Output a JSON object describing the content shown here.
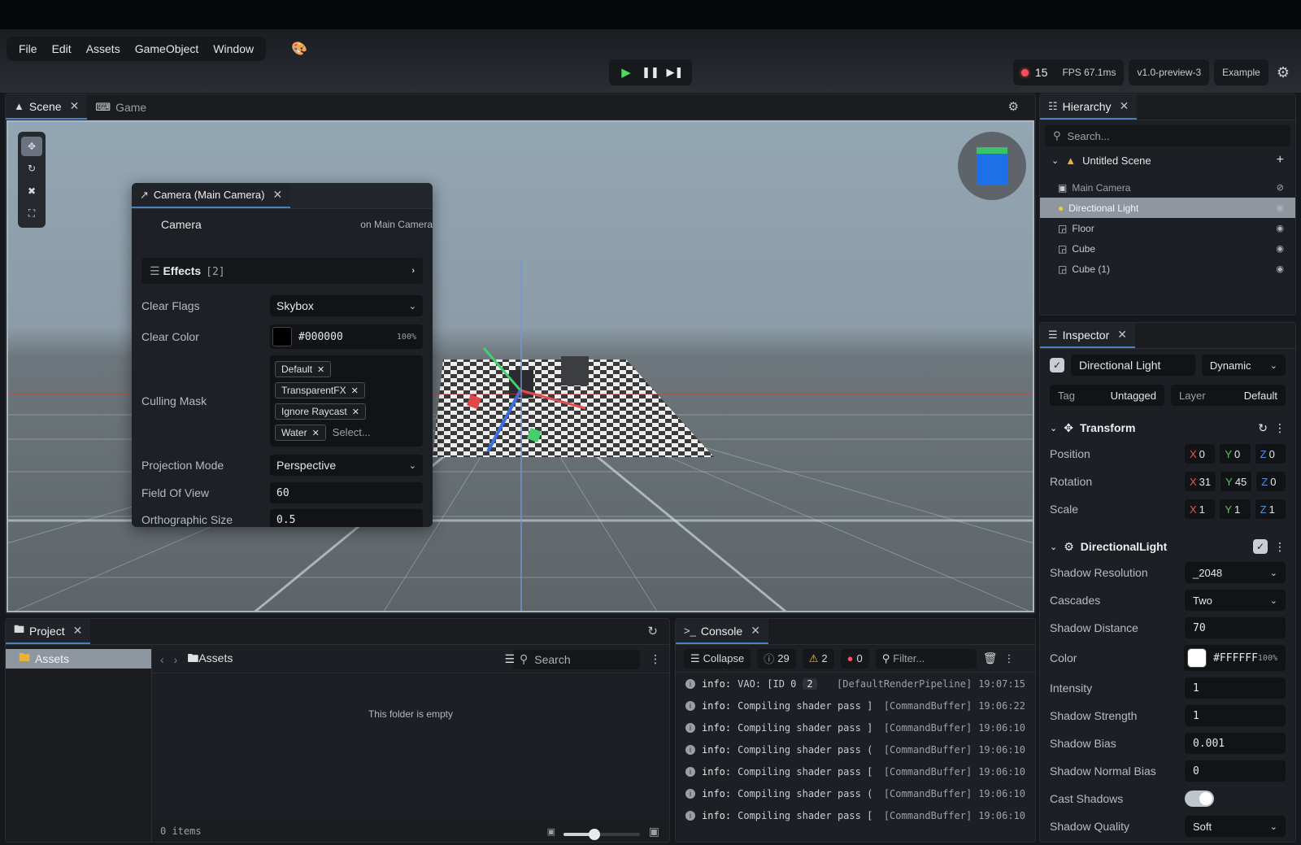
{
  "menu": [
    "File",
    "Edit",
    "Assets",
    "GameObject",
    "Window"
  ],
  "status": {
    "count": "15",
    "fps": "FPS 67.1ms",
    "version": "v1.0-preview-3",
    "project": "Example"
  },
  "scene_panel": {
    "tabs": [
      {
        "label": "Scene"
      },
      {
        "label": "Game"
      }
    ]
  },
  "camera_panel": {
    "tab": "Camera (Main Camera)",
    "component": "Camera",
    "owner": "on Main Camera",
    "effects_label": "Effects",
    "effects_count": "[2]",
    "clear_flags_label": "Clear Flags",
    "clear_flags": "Skybox",
    "clear_color_label": "Clear Color",
    "clear_color_hex": "#000000",
    "clear_color_alpha": "100%",
    "culling_mask_label": "Culling Mask",
    "culling_tags": [
      "Default",
      "TransparentFX",
      "Ignore Raycast",
      "Water"
    ],
    "culling_placeholder": "Select...",
    "projection_label": "Projection Mode",
    "projection": "Perspective",
    "fov_label": "Field Of View",
    "fov": "60",
    "ortho_label": "Orthographic Size",
    "ortho": "0.5"
  },
  "hierarchy": {
    "tab": "Hierarchy",
    "search_placeholder": "Search...",
    "scene": "Untitled Scene",
    "items": [
      "Main Camera",
      "Directional Light",
      "Floor",
      "Cube",
      "Cube (1)"
    ],
    "selected_index": 1
  },
  "inspector": {
    "tab": "Inspector",
    "object_name": "Directional Light",
    "mode": "Dynamic",
    "tag_label": "Tag",
    "tag": "Untagged",
    "layer_label": "Layer",
    "layer": "Default",
    "transform": {
      "title": "Transform",
      "position_label": "Position",
      "position": [
        "0",
        "0",
        "0"
      ],
      "rotation_label": "Rotation",
      "rotation": [
        "31",
        "45",
        "0"
      ],
      "scale_label": "Scale",
      "scale": [
        "1",
        "1",
        "1"
      ]
    },
    "light": {
      "title": "DirectionalLight",
      "shadow_resolution_label": "Shadow Resolution",
      "shadow_resolution": "_2048",
      "cascades_label": "Cascades",
      "cascades": "Two",
      "shadow_distance_label": "Shadow Distance",
      "shadow_distance": "70",
      "color_label": "Color",
      "color_hex": "#FFFFFF",
      "color_alpha": "100%",
      "intensity_label": "Intensity",
      "intensity": "1",
      "shadow_strength_label": "Shadow Strength",
      "shadow_strength": "1",
      "shadow_bias_label": "Shadow Bias",
      "shadow_bias": "0.001",
      "shadow_normal_bias_label": "Shadow Normal Bias",
      "shadow_normal_bias": "0",
      "cast_shadows_label": "Cast Shadows",
      "cast_shadows": true,
      "shadow_quality_label": "Shadow Quality",
      "shadow_quality": "Soft"
    }
  },
  "project": {
    "tab": "Project",
    "folder": "Assets",
    "breadcrumb": "Assets",
    "search_placeholder": "Search",
    "empty_text": "This folder is empty",
    "items_count": "0 items",
    "thumb_size": 0.4
  },
  "console": {
    "tab": "Console",
    "collapse_label": "Collapse",
    "info_count": "29",
    "warn_count": "2",
    "error_count": "0",
    "filter_placeholder": "Filter...",
    "rows": [
      {
        "level": "info:",
        "msg": "VAO: [ID 0",
        "badge": "2",
        "tag": "[DefaultRenderPipeline]",
        "time": "19:07:15"
      },
      {
        "level": "info:",
        "msg": "Compiling shader pass ]",
        "badge": "",
        "tag": "[CommandBuffer]",
        "time": "19:06:22"
      },
      {
        "level": "info:",
        "msg": "Compiling shader pass ]",
        "badge": "",
        "tag": "[CommandBuffer]",
        "time": "19:06:10"
      },
      {
        "level": "info:",
        "msg": "Compiling shader pass (",
        "badge": "",
        "tag": "[CommandBuffer]",
        "time": "19:06:10"
      },
      {
        "level": "info:",
        "msg": "Compiling shader pass [",
        "badge": "",
        "tag": "[CommandBuffer]",
        "time": "19:06:10"
      },
      {
        "level": "info:",
        "msg": "Compiling shader pass (",
        "badge": "",
        "tag": "[CommandBuffer]",
        "time": "19:06:10"
      },
      {
        "level": "info:",
        "msg": "Compiling shader pass [",
        "badge": "",
        "tag": "[CommandBuffer]",
        "time": "19:06:10"
      }
    ]
  }
}
